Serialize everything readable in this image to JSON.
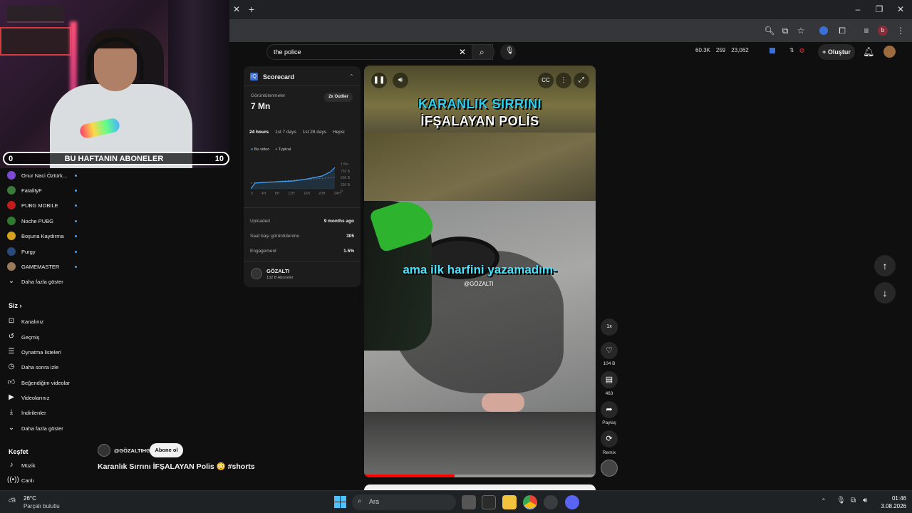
{
  "stream_overlay": {
    "sub_counter_left": "0",
    "sub_counter_title": "BU HAFTANIN ABONELER",
    "sub_counter_right": "10"
  },
  "browser": {
    "new_tab": "+",
    "window_controls": [
      "–",
      "❐",
      "✕"
    ]
  },
  "header": {
    "search_value": "the police",
    "stats": [
      "60.3K",
      "259",
      "23,062"
    ],
    "create_label": "Oluştur"
  },
  "sidebar": {
    "subscriptions": [
      {
        "label": "Onur Naci Öztürk...",
        "color": "#7b4bd6"
      },
      {
        "label": "FatalityF",
        "color": "#3a7a3a"
      },
      {
        "label": "PUBG MOBILE",
        "color": "#c01c1c"
      },
      {
        "label": "Noche PUBG",
        "color": "#2f7a2f"
      },
      {
        "label": "Boşuna Kaydırma",
        "color": "#d6a21c"
      },
      {
        "label": "Purgy",
        "color": "#2a4a7a"
      },
      {
        "label": "GAMEMASTER",
        "color": "#9a7a5a"
      }
    ],
    "show_more": "Daha fazla göster",
    "you_heading": "Siz",
    "you_items": [
      "Kanalınız",
      "Geçmiş",
      "Oynatma listeleri",
      "Daha sonra izle",
      "Beğendiğim videolar",
      "Videolarınız",
      "İndirilenler",
      "Daha fazla göster"
    ],
    "explore_heading": "Keşfet",
    "explore_items": [
      "Müzik",
      "Canlı"
    ]
  },
  "scorecard": {
    "title": "Scorecard",
    "views_label": "Görüntülenmeler",
    "views_value": "7 Mn",
    "outlier_badge": "2x Outlier",
    "tabs": [
      "24 hours",
      "1st 7 days",
      "1st 28 days",
      "Hepsi"
    ],
    "legend": [
      "Bu video",
      "Typical"
    ],
    "y_ticks": [
      "1 Mn",
      "750 B",
      "500 B",
      "250 B",
      "0"
    ],
    "x_ticks": [
      "0",
      "4H",
      "8H",
      "12H",
      "16H",
      "20H",
      "24H"
    ],
    "rows": [
      {
        "label": "Uploaded",
        "value": "9 months ago"
      },
      {
        "label": "Saat başı görüntülenme",
        "value": "305"
      },
      {
        "label": "Engagement",
        "value": "1.5%"
      }
    ],
    "channel_name": "GÖZALTI",
    "channel_subs": "132 B Aboneler"
  },
  "video": {
    "caption_line1": "KARANLIK SIRRINI",
    "caption_line2": "İFŞALAYAN POLİS",
    "subtitle": "ama ilk harfini yazamadım-",
    "watermark": "@GÖZALTI",
    "progress": 0.39
  },
  "actions": {
    "speed": "1x",
    "likes": "104 B",
    "comments": "463",
    "share": "Paylaş",
    "remix": "Remix"
  },
  "shorts": {
    "channel": "@GÖZALTIHG",
    "subscribe": "Abone ol",
    "title": "Karanlık Sırrını İFŞALAYAN Polis 😳 #shorts"
  },
  "taskbar": {
    "weather_temp": "26°C",
    "weather_desc": "Parçalı bulutlu",
    "search_placeholder": "Ara",
    "time": "01:46",
    "date": "3.08.2026"
  }
}
